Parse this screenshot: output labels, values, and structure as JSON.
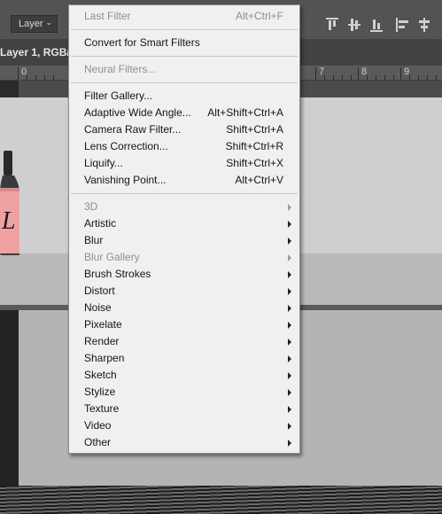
{
  "optionsbar": {
    "layer_select": "Layer"
  },
  "document": {
    "tab_title": "Layer 1, RGB/8"
  },
  "ruler": {
    "labels": [
      "0",
      "7",
      "8",
      "9"
    ]
  },
  "filter_menu": {
    "last_filter": {
      "label": "Last Filter",
      "shortcut": "Alt+Ctrl+F",
      "enabled": false
    },
    "convert_smart": {
      "label": "Convert for Smart Filters"
    },
    "neural": {
      "label": "Neural Filters...",
      "enabled": false
    },
    "filter_items": [
      {
        "label": "Filter Gallery...",
        "shortcut": ""
      },
      {
        "label": "Adaptive Wide Angle...",
        "shortcut": "Alt+Shift+Ctrl+A"
      },
      {
        "label": "Camera Raw Filter...",
        "shortcut": "Shift+Ctrl+A"
      },
      {
        "label": "Lens Correction...",
        "shortcut": "Shift+Ctrl+R"
      },
      {
        "label": "Liquify...",
        "shortcut": "Shift+Ctrl+X"
      },
      {
        "label": "Vanishing Point...",
        "shortcut": "Alt+Ctrl+V"
      }
    ],
    "submenus": [
      {
        "label": "3D",
        "enabled": false
      },
      {
        "label": "Artistic",
        "enabled": true
      },
      {
        "label": "Blur",
        "enabled": true
      },
      {
        "label": "Blur Gallery",
        "enabled": false
      },
      {
        "label": "Brush Strokes",
        "enabled": true
      },
      {
        "label": "Distort",
        "enabled": true
      },
      {
        "label": "Noise",
        "enabled": true
      },
      {
        "label": "Pixelate",
        "enabled": true
      },
      {
        "label": "Render",
        "enabled": true
      },
      {
        "label": "Sharpen",
        "enabled": true
      },
      {
        "label": "Sketch",
        "enabled": true
      },
      {
        "label": "Stylize",
        "enabled": true
      },
      {
        "label": "Texture",
        "enabled": true
      },
      {
        "label": "Video",
        "enabled": true
      },
      {
        "label": "Other",
        "enabled": true
      }
    ]
  },
  "bottle_label": "L"
}
